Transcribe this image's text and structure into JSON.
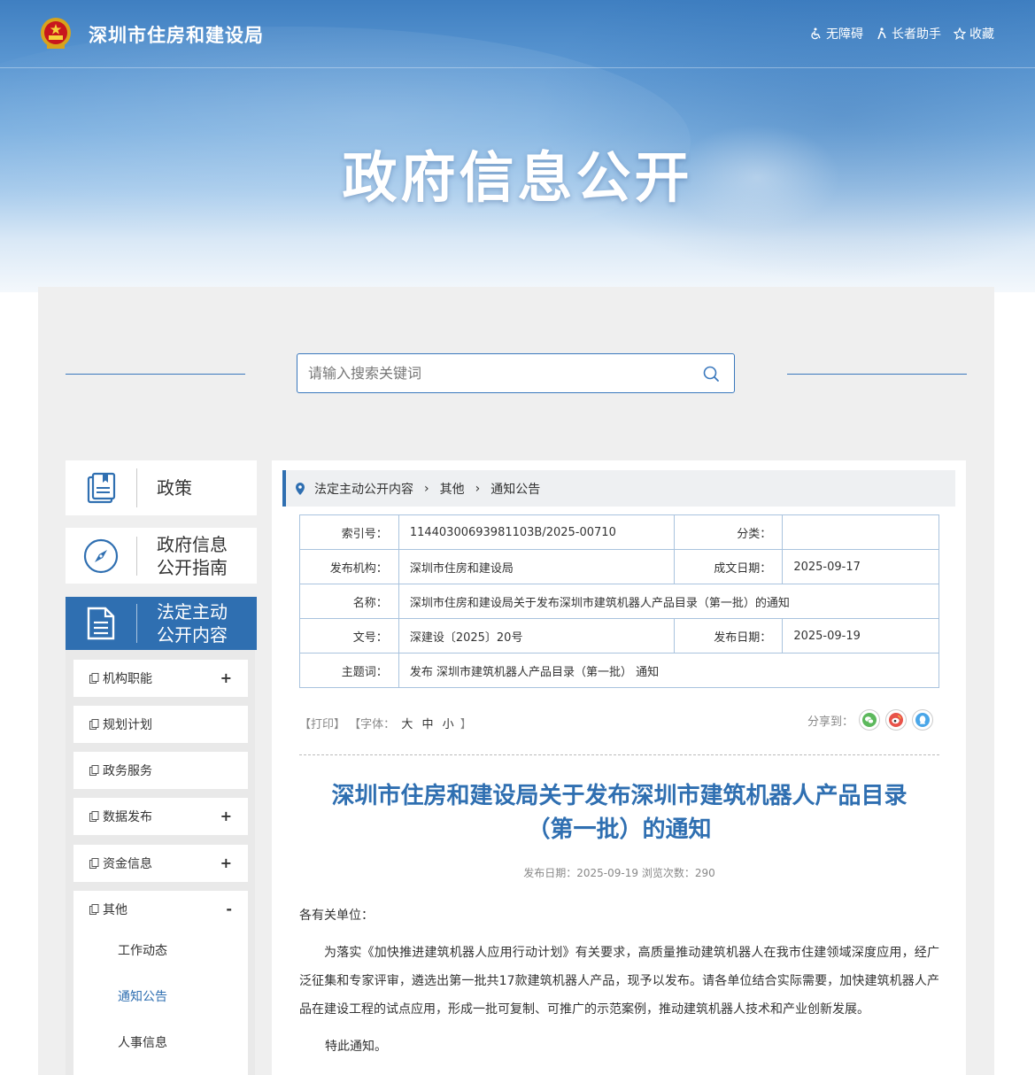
{
  "header": {
    "site_name": "深圳市住房和建设局",
    "links": [
      {
        "label": "无障碍",
        "icon": "wheelchair-icon"
      },
      {
        "label": "长者助手",
        "icon": "elder-icon"
      },
      {
        "label": "收藏",
        "icon": "star-icon"
      }
    ],
    "banner_title": "政府信息公开"
  },
  "search": {
    "placeholder": "请输入搜索关键词"
  },
  "nav_cards": [
    {
      "label_line1": "政策",
      "label_line2": "",
      "icon": "book-icon"
    },
    {
      "label_line1": "政府信息",
      "label_line2": "公开指南",
      "icon": "compass-icon"
    },
    {
      "label_line1": "法定主动",
      "label_line2": "公开内容",
      "icon": "document-icon",
      "active": true
    }
  ],
  "sidebar": {
    "items": [
      {
        "label": "机构职能",
        "toggle": "+"
      },
      {
        "label": "规划计划",
        "toggle": ""
      },
      {
        "label": "政务服务",
        "toggle": ""
      },
      {
        "label": "数据发布",
        "toggle": "+"
      },
      {
        "label": "资金信息",
        "toggle": "+"
      },
      {
        "label": "其他",
        "toggle": "-"
      }
    ],
    "sub_items": [
      {
        "label": "工作动态"
      },
      {
        "label": "通知公告",
        "current": true
      },
      {
        "label": "人事信息"
      }
    ]
  },
  "breadcrumb": [
    "法定主动公开内容",
    "其他",
    "通知公告"
  ],
  "meta_table": {
    "index_label": "索引号：",
    "index_value": "11440300693981103B/2025-00710",
    "category_label": "分类：",
    "category_value": "",
    "publisher_label": "发布机构：",
    "publisher_value": "深圳市住房和建设局",
    "written_label": "成文日期：",
    "written_value": "2025-09-17",
    "name_label": "名称：",
    "name_value": "深圳市住房和建设局关于发布深圳市建筑机器人产品目录（第一批）的通知",
    "docno_label": "文号：",
    "docno_value": "深建设〔2025〕20号",
    "pubdate_label": "发布日期：",
    "pubdate_value": "2025-09-19",
    "keywords_label": "主题词：",
    "keywords_value": "发布 深圳市建筑机器人产品目录（第一批） 通知"
  },
  "tools": {
    "print": "【打印】",
    "font_prefix": "【字体：",
    "font_large": "大",
    "font_medium": "中",
    "font_small": "小",
    "font_suffix": "】",
    "share_label": "分享到：",
    "share_icons": [
      "wechat-icon",
      "weibo-icon",
      "qq-icon"
    ]
  },
  "article": {
    "title_line1": "深圳市住房和建设局关于发布深圳市建筑机器人产品目录",
    "title_line2": "（第一批）的通知",
    "meta": "发布日期：2025-09-19  浏览次数：290",
    "salutation": "各有关单位：",
    "paragraph": "为落实《加快推进建筑机器人应用行动计划》有关要求，高质量推动建筑机器人在我市住建领域深度应用，经广泛征集和专家评审，遴选出第一批共17款建筑机器人产品，现予以发布。请各单位结合实际需要，加快建筑机器人产品在建设工程的试点应用，形成一批可复制、可推广的示范案例，推动建筑机器人技术和产业创新发展。",
    "closing": "特此通知。"
  },
  "colors": {
    "primary": "#2f6fb1",
    "title_blue": "#2f6fb1",
    "border_blue": "#a9c3de"
  }
}
